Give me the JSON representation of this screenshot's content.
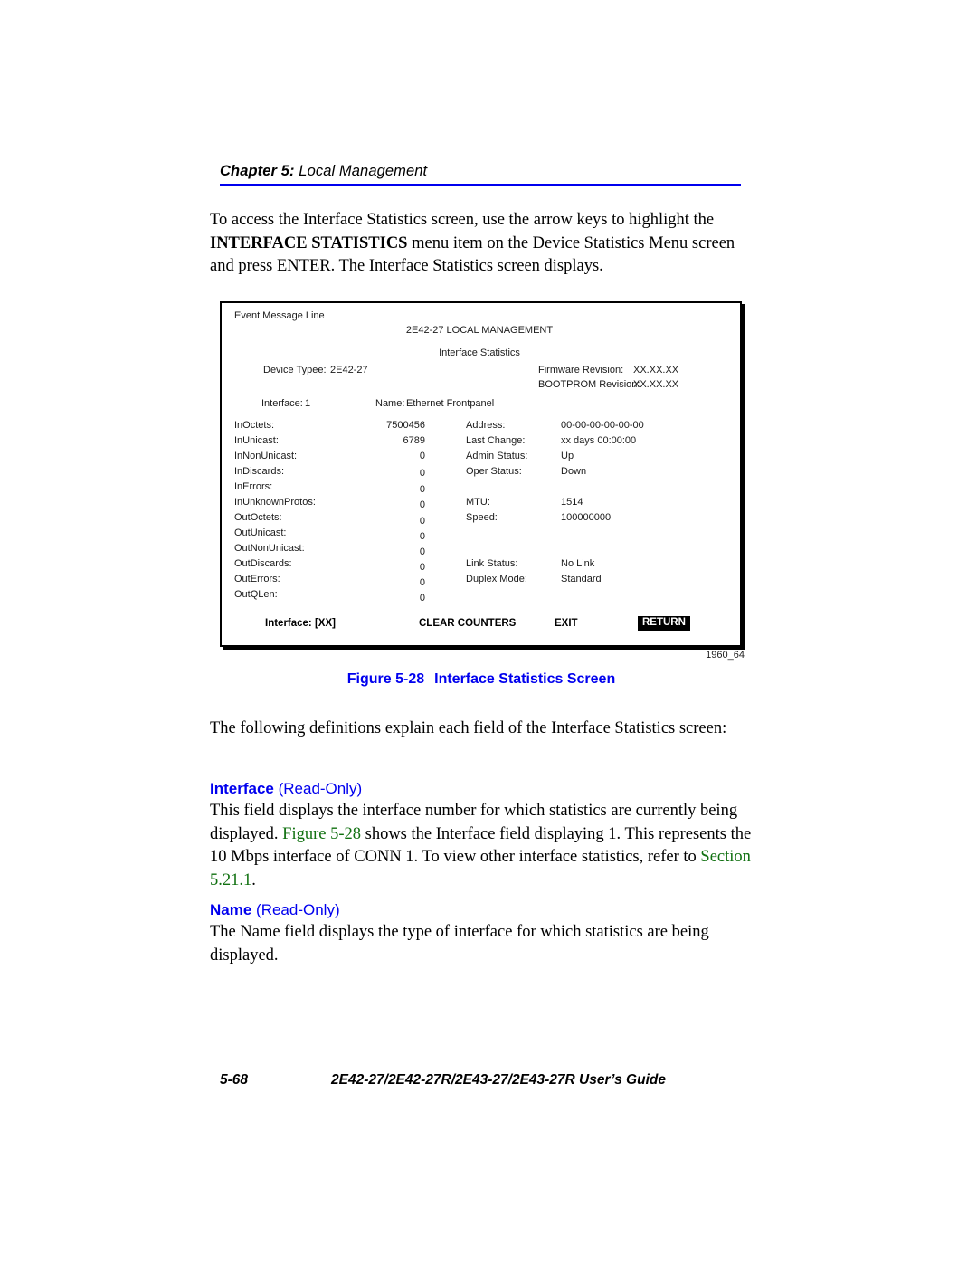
{
  "header": {
    "chapter": "Chapter 5:",
    "title": " Local Management",
    "rule_color": "#0000ee"
  },
  "intro_paragraph": {
    "part1": "To access the Interface Statistics screen, use the arrow keys to highlight the ",
    "bold": "INTERFACE STATISTICS",
    "part2": " menu item on the Device Statistics Menu screen and press ENTER. The Interface Statistics screen displays."
  },
  "terminal": {
    "event_message_line": "Event Message Line",
    "title": "2E42-27 LOCAL MANAGEMENT",
    "subtitle": "Interface  Statistics",
    "device_type_label": "Device Typee:",
    "device_type_value": "2E42-27",
    "firmware_label": "Firmware Revision:",
    "firmware_value": "XX.XX.XX",
    "bootprom_label": "BOOTPROM Revision:",
    "bootprom_value": "XX.XX.XX",
    "interface_label": "Interface:",
    "interface_value": "1",
    "name_label": "Name:",
    "name_value": "Ethernet Frontpanel",
    "left_stats": [
      {
        "label": "InOctets:",
        "value": "7500456"
      },
      {
        "label": "InUnicast:",
        "value": "6789"
      },
      {
        "label": "InNonUnicast:",
        "value": "0"
      },
      {
        "label": "InDiscards:",
        "value": "0"
      },
      {
        "label": "InErrors:",
        "value": "0"
      },
      {
        "label": "InUnknownProtos:",
        "value": "0"
      },
      {
        "label": "OutOctets:",
        "value": "0"
      },
      {
        "label": "OutUnicast:",
        "value": "0"
      },
      {
        "label": "OutNonUnicast:",
        "value": "0"
      },
      {
        "label": "OutDiscards:",
        "value": "0"
      },
      {
        "label": "OutErrors:",
        "value": "0"
      },
      {
        "label": "OutQLen:",
        "value": "0"
      }
    ],
    "right_stats": [
      {
        "label": "Address:",
        "value": "00-00-00-00-00-00"
      },
      {
        "label": "Last Change:",
        "value": "xx days 00:00:00"
      },
      {
        "label": "Admin Status:",
        "value": "Up"
      },
      {
        "label": "Oper Status:",
        "value": "Down"
      },
      {
        "label": "MTU:",
        "value": "1514"
      },
      {
        "label": "Speed:",
        "value": "100000000"
      },
      {
        "label": "Link Status:",
        "value": "No Link"
      },
      {
        "label": "Duplex Mode:",
        "value": "Standard"
      }
    ],
    "footer_interface": "Interface:  [XX]",
    "btn_clear_counters": "CLEAR COUNTERS",
    "btn_exit": "EXIT",
    "btn_return": "RETURN"
  },
  "figure": {
    "id": "1960_64",
    "caption_number": "Figure 5-28",
    "caption_title": "Interface Statistics Screen",
    "caption_color": "#0000ee"
  },
  "definitions_intro": "The following definitions explain each field of the Interface Statistics screen:",
  "interface_section": {
    "heading_name": "Interface",
    "heading_mode": " (Read-Only)",
    "body_p1": "This field displays the interface number for which statistics are currently being displayed. ",
    "xref1": "Figure 5-28",
    "body_p2": " shows the Interface field displaying 1. This represents the 10 Mbps interface of CONN 1. To view other interface statistics, refer to ",
    "xref2": "Section 5.21.1",
    "body_p3": "."
  },
  "name_section": {
    "heading_name": "Name",
    "heading_mode": " (Read-Only)",
    "body": "The Name field displays the type of interface for which statistics are being displayed."
  },
  "footer": {
    "page_number": "5-68",
    "guide_title": "2E42-27/2E42-27R/2E43-27/2E43-27R User’s Guide"
  }
}
